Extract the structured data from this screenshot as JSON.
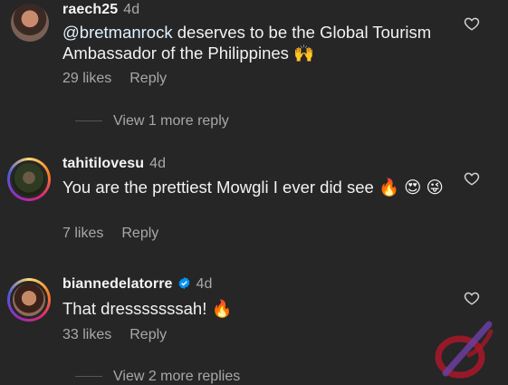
{
  "comments": [
    {
      "username": "raech25",
      "time": "4d",
      "mention": "@bretmanrock",
      "text": " deserves to be the Global Tourism Ambassador of the Philippines 🙌",
      "likes": "29 likes",
      "reply": "Reply",
      "view_replies": "View 1 more reply"
    },
    {
      "username": "tahitilovesu",
      "time": "4d",
      "text": "You are the prettiest Mowgli I ever did see 🔥 😍 😜",
      "likes": "7 likes",
      "reply": "Reply"
    },
    {
      "username": "biannedelatorre",
      "time": "4d",
      "verified": true,
      "text": "That dresssssssah! 🔥",
      "likes": "33 likes",
      "reply": "Reply",
      "view_replies": "View 2 more replies"
    }
  ],
  "icons": {
    "like": "heart-outline-icon",
    "verified": "verified-badge-icon"
  },
  "colors": {
    "background": "#262626",
    "secondary_text": "#a8a8a8",
    "verified_blue": "#0095f6"
  }
}
